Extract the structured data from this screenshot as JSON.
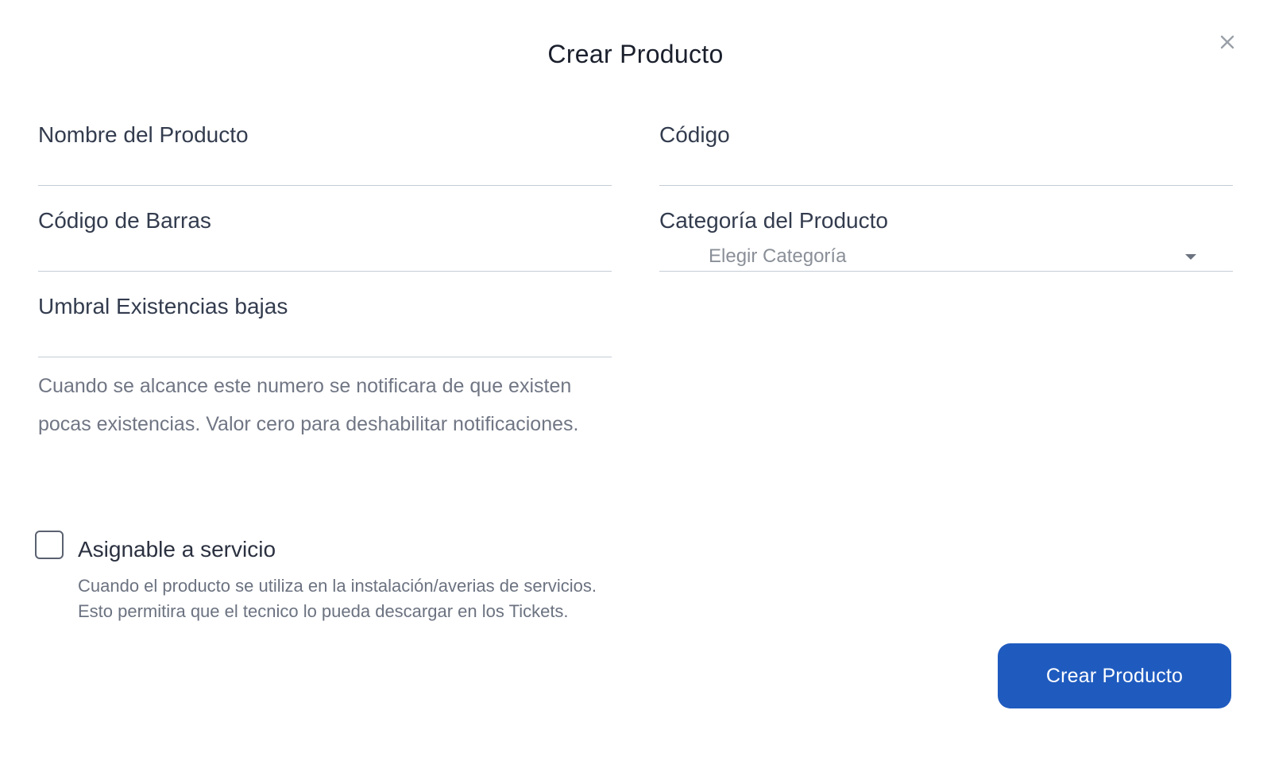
{
  "modal": {
    "title": "Crear Producto",
    "close_label": "×"
  },
  "form": {
    "product_name": {
      "label": "Nombre del Producto",
      "value": ""
    },
    "code": {
      "label": "Código",
      "value": ""
    },
    "barcode": {
      "label": "Código de Barras",
      "value": ""
    },
    "category": {
      "label": "Categoría del Producto",
      "selected": "Elegir Categoría"
    },
    "low_stock_threshold": {
      "label": "Umbral Existencias bajas",
      "value": "",
      "help": "Cuando se alcance este numero se notificara de que existen pocas existencias. Valor cero para deshabilitar notificaciones."
    },
    "assignable": {
      "label": "Asignable a servicio",
      "checked": false,
      "description_line1": "Cuando el producto se utiliza en la instalación/averias de servicios.",
      "description_line2": "Esto permitira que el tecnico lo pueda descargar en los Tickets."
    },
    "submit_label": "Crear Producto"
  },
  "colors": {
    "primary": "#1f5bbf",
    "border": "#c4ccd6",
    "label": "#333c4e",
    "muted": "#707684"
  },
  "icons": {
    "close": "close-icon",
    "dropdown": "chevron-down-icon"
  }
}
